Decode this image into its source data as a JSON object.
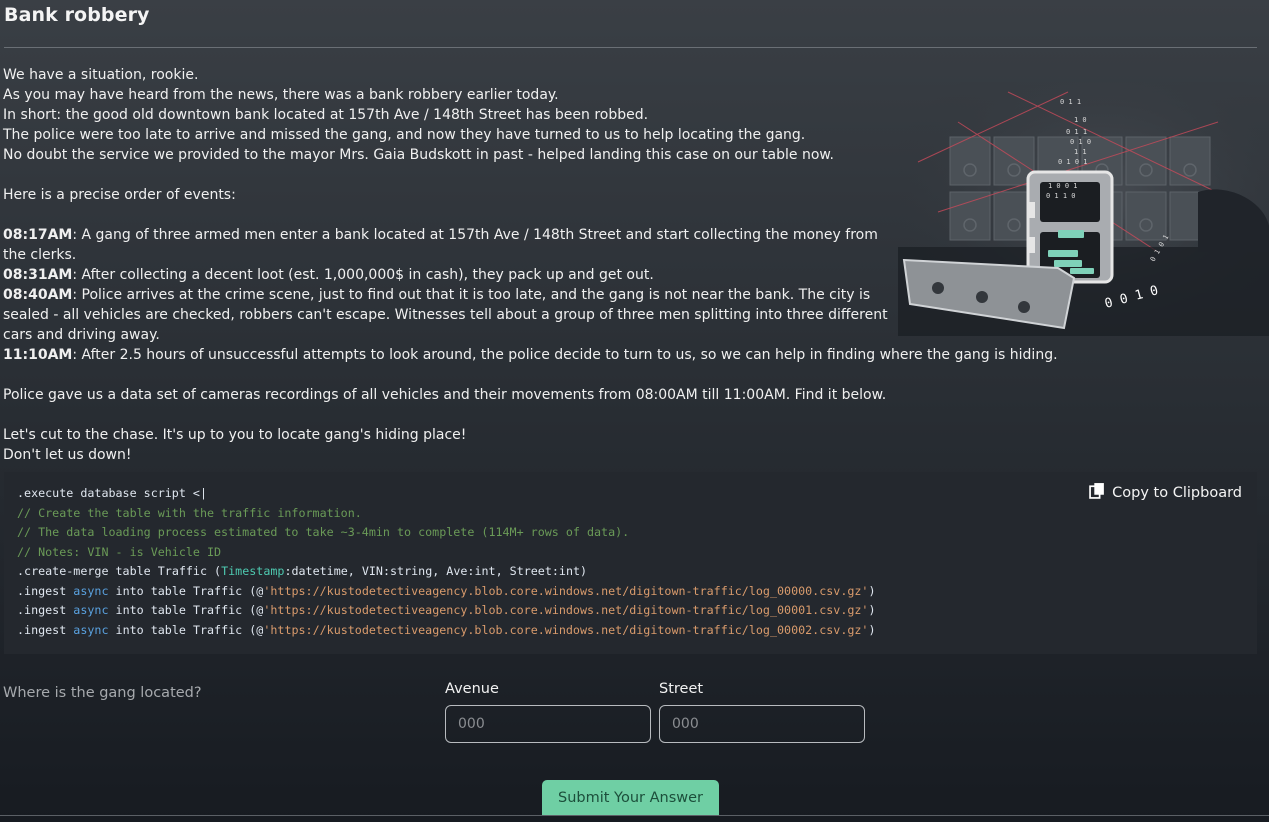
{
  "page": {
    "title": "Bank robbery"
  },
  "story": {
    "intro": [
      "We have a situation, rookie.",
      "As you may have heard from the news, there was a bank robbery earlier today.",
      "In short: the good old downtown bank located at 157th Ave / 148th Street has been robbed.",
      "The police were too late to arrive and missed the gang, and now they have turned to us to help locating the gang.",
      "No doubt the service we provided to the mayor Mrs. Gaia Budskott in past - helped landing this case on our table now."
    ],
    "events_heading": "Here is a precise order of events:",
    "events": [
      {
        "time": "08:17AM",
        "text": ": A gang of three armed men enter a bank located at 157th Ave / 148th Street and start collecting the money from the clerks."
      },
      {
        "time": "08:31AM",
        "text": ": After collecting a decent loot (est. 1,000,000$ in cash), they pack up and get out."
      },
      {
        "time": "08:40AM",
        "text": ": Police arrives at the crime scene, just to find out that it is too late, and the gang is not near the bank. The city is sealed - all vehicles are checked, robbers can't escape. Witnesses tell about a group of three men splitting into three different cars and driving away."
      },
      {
        "time": "11:10AM",
        "text": ": After 2.5 hours of unsuccessful attempts to look around, the police decide to turn to us, so we can help in finding where the gang is hiding."
      }
    ],
    "dataset_note": "Police gave us a data set of cameras recordings of all vehicles and their movements from 08:00AM till 11:00AM. Find it below.",
    "closing_1": "Let's cut to the chase. It's up to you to locate gang's hiding place!",
    "closing_2": "Don't let us down!"
  },
  "code": {
    "copy_label": "Copy to Clipboard",
    "line1": ".execute database script <|",
    "comment1": "// Create the table with the traffic information.",
    "comment2": "// The data loading process estimated to take ~3-4min to complete (114M+ rows of data).",
    "comment3": "// Notes: VIN - is Vehicle ID",
    "create_kw": ".create-merge",
    "create_tbl": " table ",
    "table_name": "Traffic",
    "create_schema_open": " (",
    "col1": "Timestamp",
    "col1_type": ":datetime",
    "col2": ", VIN",
    "col2_type": ":string",
    "col3": ", Ave",
    "col3_type": ":int",
    "col4": ", Street",
    "col4_type": ":int",
    "create_close": ")",
    "ingest_kw": ".ingest",
    "async_kw": " async ",
    "into_kw": "into table ",
    "open_paren": " (@",
    "close_paren": ")",
    "urls": [
      "'https://kustodetectiveagency.blob.core.windows.net/digitown-traffic/log_00000.csv.gz'",
      "'https://kustodetectiveagency.blob.core.windows.net/digitown-traffic/log_00001.csv.gz'",
      "'https://kustodetectiveagency.blob.core.windows.net/digitown-traffic/log_00002.csv.gz'"
    ]
  },
  "answer": {
    "question": "Where is the gang located?",
    "avenue_label": "Avenue",
    "avenue_placeholder": "000",
    "street_label": "Street",
    "street_placeholder": "000",
    "submit_label": "Submit Your Answer"
  },
  "illustration": {
    "binary_text": [
      "0 1 1",
      "1 0",
      "0 1 1",
      "0 1 0",
      "1 1",
      "0 1 0 1",
      "1 0 0 1",
      "0 1 1 0",
      "0 1 0 1",
      "1 0 1 0 0",
      "0 0 1 0"
    ]
  }
}
